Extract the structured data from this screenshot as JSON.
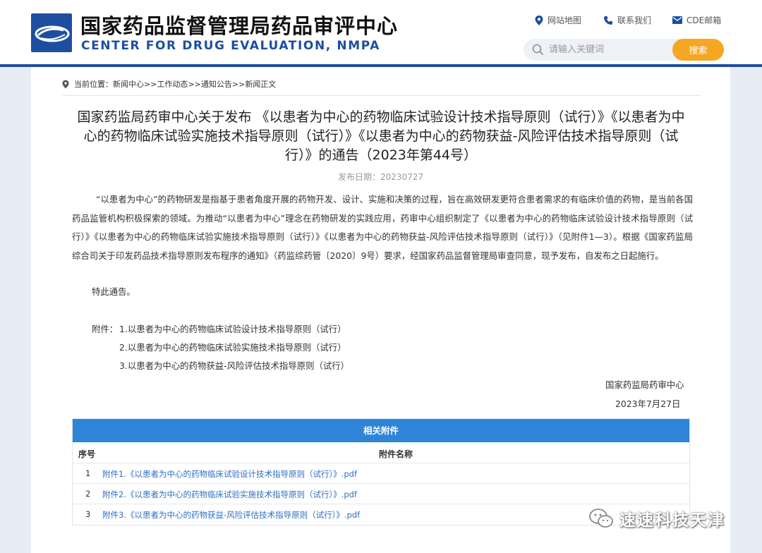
{
  "header": {
    "title_cn": "国家药品监督管理局药品审评中心",
    "title_en": "CENTER FOR DRUG EVALUATION, NMPA",
    "links": [
      {
        "label": "网站地图",
        "icon": "location-pin-icon"
      },
      {
        "label": "联系我们",
        "icon": "phone-icon"
      },
      {
        "label": "CDE邮箱",
        "icon": "mail-icon"
      }
    ],
    "search": {
      "placeholder": "请输入关键词",
      "button_label": "搜索"
    },
    "colors": {
      "brand": "#1d4ea0",
      "search_button": "#f5a623"
    }
  },
  "breadcrumb": {
    "prefix": "当前位置：",
    "items": [
      "新闻中心",
      "工作动态",
      "通知公告",
      "新闻正文"
    ],
    "separator": ">>"
  },
  "article": {
    "title": "国家药监局药审中心关于发布 《以患者为中心的药物临床试验设计技术指导原则（试行）》《以患者为中心的药物临床试验实施技术指导原则（试行）》《以患者为中心的药物获益-风险评估技术指导原则（试行）》的通告（2023年第44号）",
    "date_label": "发布日期：",
    "date_value": "20230727",
    "paragraph1": "“以患者为中心”的药物研发是指基于患者角度开展的药物开发、设计、实施和决策的过程，旨在高效研发更符合患者需求的有临床价值的药物，是当前各国药品监管机构积极探索的领域。为推动“以患者为中心”理念在药物研发的实践应用，药审中心组织制定了《以患者为中心的药物临床试验设计技术指导原则（试行）》《以患者为中心的药物临床试验实施技术指导原则（试行）》《以患者为中心的药物获益-风险评估技术指导原则（试行）》（见附件1—3）。根据《国家药监局综合司关于印发药品技术指导原则发布程序的通知》（药监综药管〔2020〕9号）要求，经国家药品监督管理局审查同意，现予发布，自发布之日起施行。",
    "paragraph2": "特此通告。",
    "attachments_label": "附件：",
    "attachment_items": [
      "1.以患者为中心的药物临床试验设计技术指导原则（试行）",
      "2.以患者为中心的药物临床试验实施技术指导原则（试行）",
      "3.以患者为中心的药物获益-风险评估技术指导原则（试行）"
    ],
    "signature_org": "国家药监局药审中心",
    "signature_date": "2023年7月27日"
  },
  "attachments_table": {
    "heading": "相关附件",
    "col_no": "序号",
    "col_name": "附件名称",
    "rows": [
      {
        "no": "1",
        "name": "附件1.《以患者为中心的药物临床试验设计技术指导原则（试行）》.pdf"
      },
      {
        "no": "2",
        "name": "附件2.《以患者为中心的药物临床试验实施技术指导原则（试行）》.pdf"
      },
      {
        "no": "3",
        "name": "附件3.《以患者为中心的药物获益-风险评估技术指导原则（试行）》.pdf"
      }
    ],
    "colors": {
      "heading_bg": "#2e85d8",
      "link": "#2e6fc2"
    }
  },
  "watermark": {
    "text": "速速科技天津",
    "icon": "wechat-icon"
  }
}
